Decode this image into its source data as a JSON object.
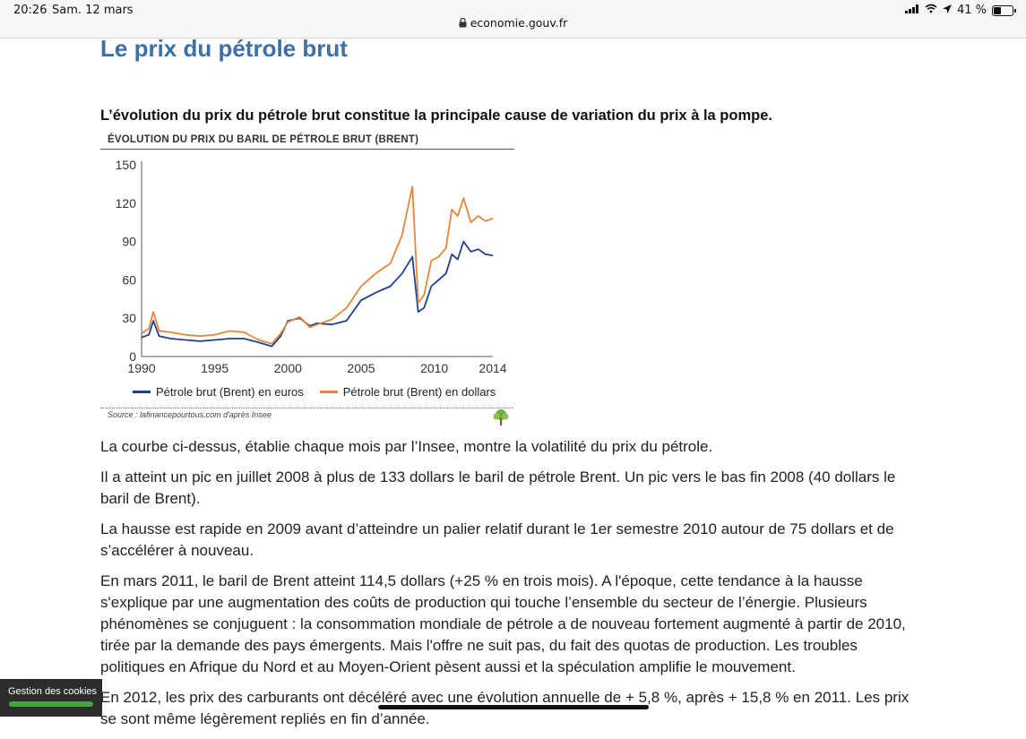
{
  "status_bar": {
    "time": "20:26",
    "date": "Sam. 12 mars",
    "url": "economie.gouv.fr",
    "battery": "41 %",
    "battery_level": 0.41
  },
  "page": {
    "title": "Le prix du pétrole brut",
    "lead": "L’évolution du prix du pétrole brut constitue la principale cause de variation du prix à la pompe.",
    "paragraphs": [
      "La courbe ci-dessus, établie chaque mois par l’Insee, montre la volatilité du prix du pétrole.",
      "Il a atteint un pic en juillet 2008 à plus de 133 dollars le baril de pétrole Brent. Un pic vers le bas fin 2008 (40 dollars le baril de Brent).",
      "La hausse est rapide en 2009 avant d’atteindre un palier relatif durant le 1er semestre 2010 autour de 75 dollars et de s’accélérer à nouveau.",
      "En mars 2011, le baril de Brent atteint 114,5 dollars (+25 % en trois mois). A l'époque, cette tendance à la hausse s'explique par une augmentation des coûts de production qui touche l’ensemble du secteur de l’énergie. Plusieurs phénomènes se conjuguent : la consommation mondiale de pétrole a de nouveau fortement augmenté à partir de 2010, tirée par la demande des pays émergents. Mais l'offre ne suit pas, du fait des quotas de production. Les troubles politiques en Afrique du Nord et au Moyen-Orient pèsent aussi et la spéculation amplifie le mouvement.",
      "En 2012, les prix des carburants ont décéléré avec une évolution annuelle de + 5,8 %, après + 15,8 % en 2011. Les prix se sont même légèrement repliés en fin d’année."
    ]
  },
  "cookie": {
    "label": "Gestion des cookies"
  },
  "chart_data": {
    "type": "line",
    "title": "ÉVOLUTION DU PRIX DU BARIL DE PÉTROLE BRUT (BRENT)",
    "source": "Source : lafinancepourtous.com d'après Insee",
    "x_ticks": [
      "1990",
      "1995",
      "2000",
      "2005",
      "2010",
      "2014"
    ],
    "y_ticks": [
      "0",
      "30",
      "60",
      "90",
      "120",
      "150"
    ],
    "xlim": [
      1990,
      2014
    ],
    "ylim": [
      0,
      150
    ],
    "series": [
      {
        "name": "Pétrole brut (Brent) en euros",
        "color": "#1f3f8f",
        "x": [
          1990,
          1990.5,
          1990.8,
          1991.2,
          1992,
          1993,
          1994,
          1995,
          1996,
          1997,
          1998,
          1998.9,
          1999.5,
          2000,
          2000.8,
          2001.5,
          2002,
          2003,
          2004,
          2005,
          2006,
          2007,
          2007.8,
          2008.5,
          2008.9,
          2009.3,
          2009.8,
          2010.3,
          2010.8,
          2011.2,
          2011.6,
          2012,
          2012.5,
          2013,
          2013.5,
          2014
        ],
        "y": [
          15,
          17,
          28,
          16,
          14,
          13,
          12,
          13,
          14,
          14,
          11,
          8,
          16,
          28,
          30,
          24,
          26,
          25,
          28,
          44,
          50,
          55,
          65,
          78,
          35,
          38,
          55,
          60,
          65,
          80,
          76,
          90,
          82,
          84,
          80,
          79
        ]
      },
      {
        "name": "Pétrole brut (Brent) en dollars",
        "color": "#e8853a",
        "x": [
          1990,
          1990.5,
          1990.8,
          1991.2,
          1992,
          1993,
          1994,
          1995,
          1996,
          1997,
          1998,
          1998.9,
          1999.5,
          2000,
          2000.8,
          2001.5,
          2002,
          2003,
          2004,
          2005,
          2006,
          2007,
          2007.8,
          2008.5,
          2008.9,
          2009.3,
          2009.8,
          2010.3,
          2010.8,
          2011.2,
          2011.6,
          2012,
          2012.5,
          2013,
          2013.5,
          2014
        ],
        "y": [
          18,
          22,
          35,
          20,
          19,
          17,
          16,
          17,
          20,
          19,
          13,
          10,
          18,
          27,
          31,
          23,
          25,
          29,
          38,
          55,
          65,
          73,
          95,
          133,
          42,
          48,
          75,
          78,
          85,
          115,
          110,
          124,
          105,
          110,
          106,
          108
        ]
      }
    ],
    "grid": false,
    "legend": "bottom"
  }
}
